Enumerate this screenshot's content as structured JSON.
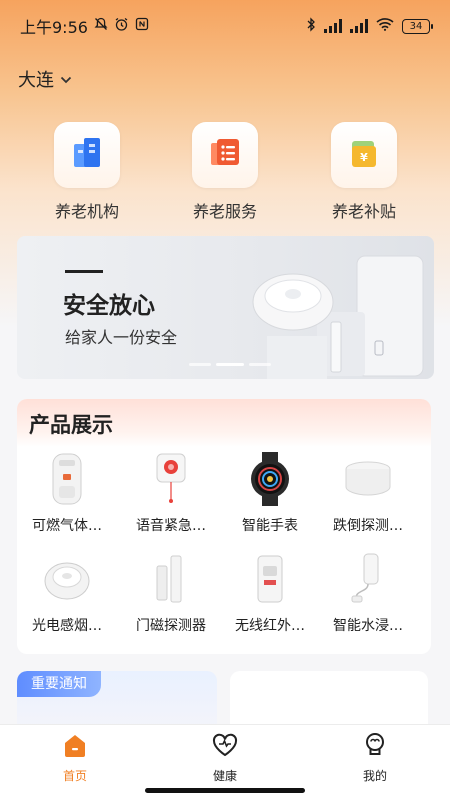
{
  "status_bar": {
    "time": "上午9:56",
    "battery": "34",
    "accent": "#1a1a1a"
  },
  "location": {
    "city": "大连"
  },
  "services": [
    {
      "label": "养老机构",
      "icon": "building-icon",
      "color": "#3b7bf5"
    },
    {
      "label": "养老服务",
      "icon": "service-list-icon",
      "color": "#f05a32"
    },
    {
      "label": "养老补贴",
      "icon": "subsidy-yen-icon",
      "color": "#f5b82e"
    }
  ],
  "banner": {
    "title": "安全放心",
    "subtitle": "给家人一份安全"
  },
  "products": {
    "title": "产品展示",
    "items": [
      {
        "name": "可燃气体…",
        "icon": "gas-detector-icon"
      },
      {
        "name": "语音紧急…",
        "icon": "emergency-button-icon"
      },
      {
        "name": "智能手表",
        "icon": "smartwatch-icon"
      },
      {
        "name": "跌倒探测…",
        "icon": "fall-detector-icon"
      },
      {
        "name": "光电感烟…",
        "icon": "smoke-detector-icon"
      },
      {
        "name": "门磁探测器",
        "icon": "door-sensor-icon"
      },
      {
        "name": "无线红外…",
        "icon": "infrared-sensor-icon"
      },
      {
        "name": "智能水浸…",
        "icon": "water-sensor-icon"
      }
    ]
  },
  "notice": {
    "tag": "重要通知"
  },
  "tabs": [
    {
      "label": "首页",
      "icon": "home-icon",
      "active": true
    },
    {
      "label": "健康",
      "icon": "heart-icon",
      "active": false
    },
    {
      "label": "我的",
      "icon": "profile-icon",
      "active": false
    }
  ],
  "colors": {
    "brand": "#f07f23",
    "header_gradient_top": "#f6a35e",
    "notice_tag": "#5f8dff"
  }
}
